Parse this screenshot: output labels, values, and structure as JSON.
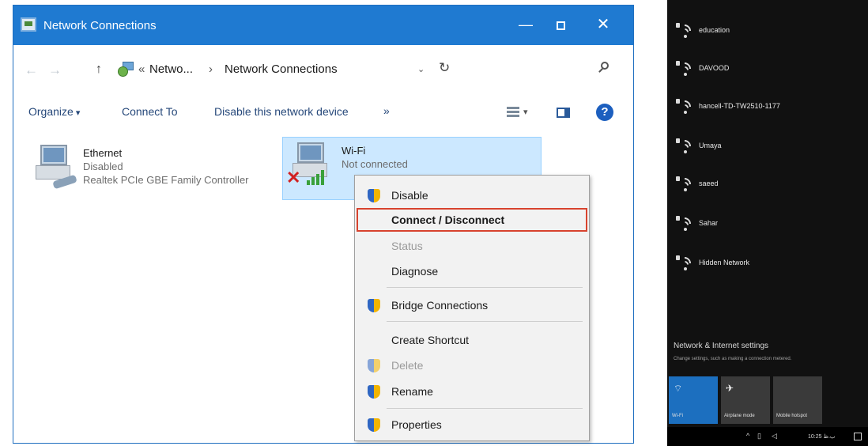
{
  "window": {
    "title": "Network Connections",
    "controls": {
      "minimize": "—",
      "maximize": "",
      "close": "✕"
    }
  },
  "address_bar": {
    "back": "←",
    "forward": "→",
    "up": "↑",
    "overflow": "«",
    "crumb_1": "Netwo...",
    "separator": "›",
    "crumb_2": "Network Connections",
    "dropdown": "⌄",
    "refresh": "↻"
  },
  "command_bar": {
    "organize": "Organize",
    "connect_to": "Connect To",
    "disable_device": "Disable this network device",
    "more": "»",
    "view_dropdown": "▾",
    "help": "?"
  },
  "connections": [
    {
      "name": "Ethernet",
      "status": "Disabled",
      "device": "Realtek PCIe GBE Family Controller"
    },
    {
      "name": "Wi-Fi",
      "status": "Not connected",
      "device": ""
    }
  ],
  "context_menu": {
    "items": [
      {
        "label": "Disable",
        "shield": true,
        "bold": false,
        "disabled": false,
        "highlighted": false
      },
      {
        "label": "Connect / Disconnect",
        "shield": false,
        "bold": true,
        "disabled": false,
        "highlighted": true
      },
      {
        "label": "Status",
        "shield": false,
        "bold": false,
        "disabled": true,
        "highlighted": false
      },
      {
        "label": "Diagnose",
        "shield": false,
        "bold": false,
        "disabled": false,
        "highlighted": false
      },
      {
        "label": "Bridge Connections",
        "shield": true,
        "bold": false,
        "disabled": false,
        "highlighted": false
      },
      {
        "label": "Create Shortcut",
        "shield": false,
        "bold": false,
        "disabled": false,
        "highlighted": false
      },
      {
        "label": "Delete",
        "shield": true,
        "bold": false,
        "disabled": true,
        "highlighted": false
      },
      {
        "label": "Rename",
        "shield": true,
        "bold": false,
        "disabled": false,
        "highlighted": false
      },
      {
        "label": "Properties",
        "shield": true,
        "bold": false,
        "disabled": false,
        "highlighted": false
      }
    ]
  },
  "flyout": {
    "networks": [
      "education",
      "DAVOOD",
      "hancell-TD-TW2510-1177",
      "Umaya",
      "saeed",
      "Sahar",
      "Hidden Network"
    ],
    "settings_title": "Network & Internet settings",
    "settings_subtitle": "Change settings, such as making a connection metered.",
    "tiles": [
      {
        "label": "Wi-Fi",
        "icon": "⌔"
      },
      {
        "label": "Airplane mode",
        "icon": "✈"
      },
      {
        "label": "Mobile hotspot",
        "icon": ""
      }
    ],
    "taskbar": {
      "chevron": "^",
      "network": "▯",
      "volume": "◁",
      "time": "10:25 ب.ظ"
    }
  },
  "colors": {
    "title_bar": "#1f7ad1",
    "selection": "#cce8ff",
    "highlight_border": "#d8432e",
    "flyout_bg": "#111111",
    "tile_active": "#1c6fbf"
  }
}
